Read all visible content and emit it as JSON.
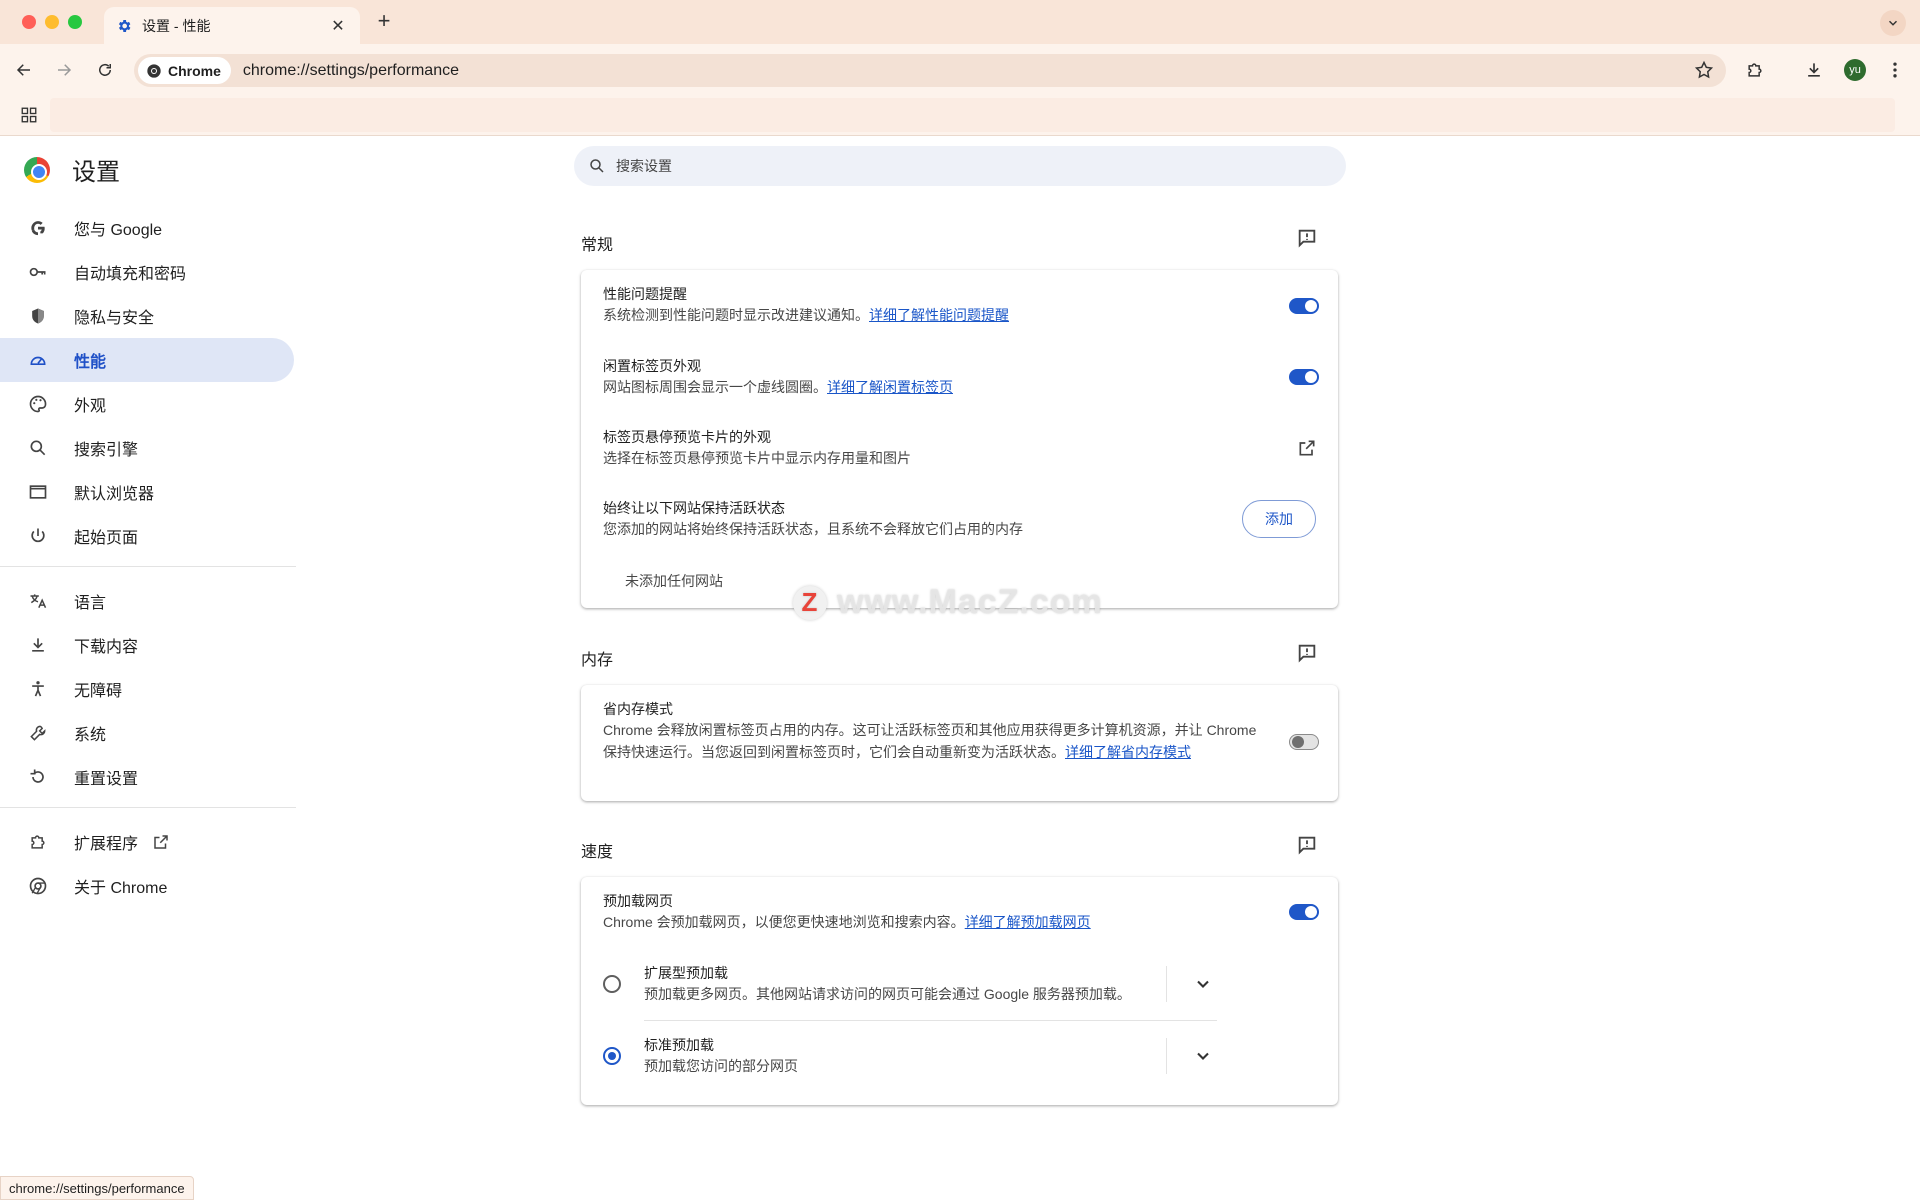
{
  "browser": {
    "tab_title": "设置 - 性能",
    "omnibox_chip": "Chrome",
    "url": "chrome://settings/performance",
    "avatar_initials": "yu",
    "status_url": "chrome://settings/performance"
  },
  "sidebar": {
    "title": "设置",
    "items": [
      {
        "label": "您与 Google",
        "icon": "google-icon"
      },
      {
        "label": "自动填充和密码",
        "icon": "key-icon"
      },
      {
        "label": "隐私与安全",
        "icon": "shield-icon"
      },
      {
        "label": "性能",
        "icon": "speedometer-icon"
      },
      {
        "label": "外观",
        "icon": "palette-icon"
      },
      {
        "label": "搜索引擎",
        "icon": "search-icon"
      },
      {
        "label": "默认浏览器",
        "icon": "browser-window-icon"
      },
      {
        "label": "起始页面",
        "icon": "power-icon"
      },
      {
        "label": "语言",
        "icon": "translate-icon"
      },
      {
        "label": "下载内容",
        "icon": "download-icon"
      },
      {
        "label": "无障碍",
        "icon": "accessibility-icon"
      },
      {
        "label": "系统",
        "icon": "wrench-icon"
      },
      {
        "label": "重置设置",
        "icon": "reset-icon"
      },
      {
        "label": "扩展程序",
        "icon": "puzzle-icon"
      },
      {
        "label": "关于 Chrome",
        "icon": "chrome-icon"
      }
    ]
  },
  "search": {
    "placeholder": "搜索设置"
  },
  "general": {
    "title": "常规",
    "alerts_title": "性能问题提醒",
    "alerts_desc": "系统检测到性能问题时显示改进建议通知。",
    "alerts_link": "详细了解性能问题提醒",
    "inactive_title": "闲置标签页外观",
    "inactive_desc": "网站图标周围会显示一个虚线圆圈。",
    "inactive_link": "详细了解闲置标签页",
    "hover_title": "标签页悬停预览卡片的外观",
    "hover_desc": "选择在标签页悬停预览卡片中显示内存用量和图片",
    "keep_title": "始终让以下网站保持活跃状态",
    "keep_desc": "您添加的网站将始终保持活跃状态，且系统不会释放它们占用的内存",
    "add_label": "添加",
    "empty_label": "未添加任何网站"
  },
  "memory": {
    "title": "内存",
    "saver_title": "省内存模式",
    "saver_desc": "Chrome 会释放闲置标签页占用的内存。这可让活跃标签页和其他应用获得更多计算机资源，并让 Chrome 保持快速运行。当您返回到闲置标签页时，它们会自动重新变为活跃状态。",
    "saver_link": "详细了解省内存模式"
  },
  "speed": {
    "title": "速度",
    "preload_title": "预加载网页",
    "preload_desc": "Chrome 会预加载网页，以便您更快速地浏览和搜索内容。",
    "preload_link": "详细了解预加载网页",
    "extended_title": "扩展型预加载",
    "extended_desc": "预加载更多网页。其他网站请求访问的网页可能会通过 Google 服务器预加载。",
    "standard_title": "标准预加载",
    "standard_desc": "预加载您访问的部分网页"
  },
  "watermark": {
    "text": "www.MacZ.com",
    "badge": "Z"
  },
  "colors": {
    "accent": "#1f57c8",
    "tabstrip": "#f9e5d8",
    "active_nav": "#dfe6f6"
  }
}
